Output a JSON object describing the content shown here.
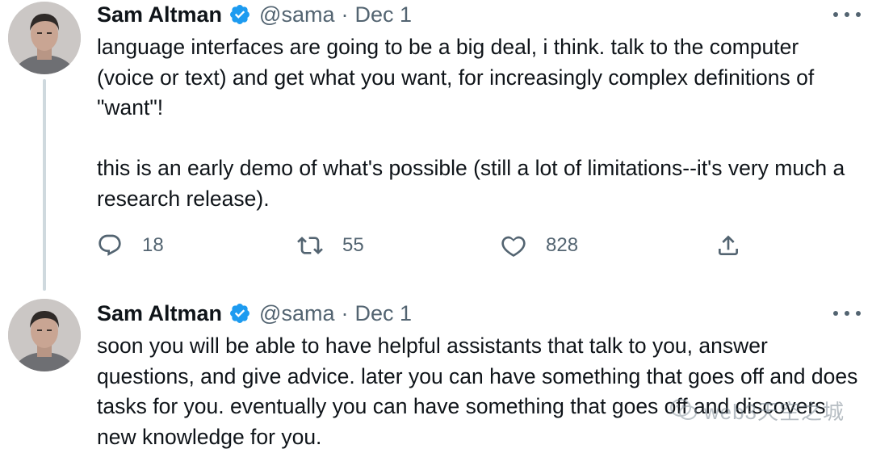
{
  "tweets": [
    {
      "author_name": "Sam Altman",
      "handle": "@sama",
      "separator": "·",
      "date": "Dec 1",
      "text": "language interfaces are going to be a big deal, i think. talk to the computer (voice or text) and get what you want, for increasingly complex definitions of \"want\"!\n\nthis is an early demo of what's possible (still a lot of limitations--it's very much a research release).",
      "replies": "18",
      "retweets": "55",
      "likes": "828"
    },
    {
      "author_name": "Sam Altman",
      "handle": "@sama",
      "separator": "·",
      "date": "Dec 1",
      "text": "soon you will be able to have helpful assistants that talk to you, answer questions, and give advice. later you can have something that goes off and does tasks for you. eventually you can have something that goes off and discovers new knowledge for you."
    }
  ],
  "watermark": {
    "text": "web3天空之城"
  },
  "colors": {
    "text": "#0f1419",
    "secondary": "#536471",
    "verified": "#1d9bf0",
    "thread_line": "#cfd9de"
  },
  "icons": [
    "reply-icon",
    "retweet-icon",
    "like-icon",
    "share-icon",
    "verified-badge-icon",
    "more-options-icon",
    "wechat-icon"
  ]
}
